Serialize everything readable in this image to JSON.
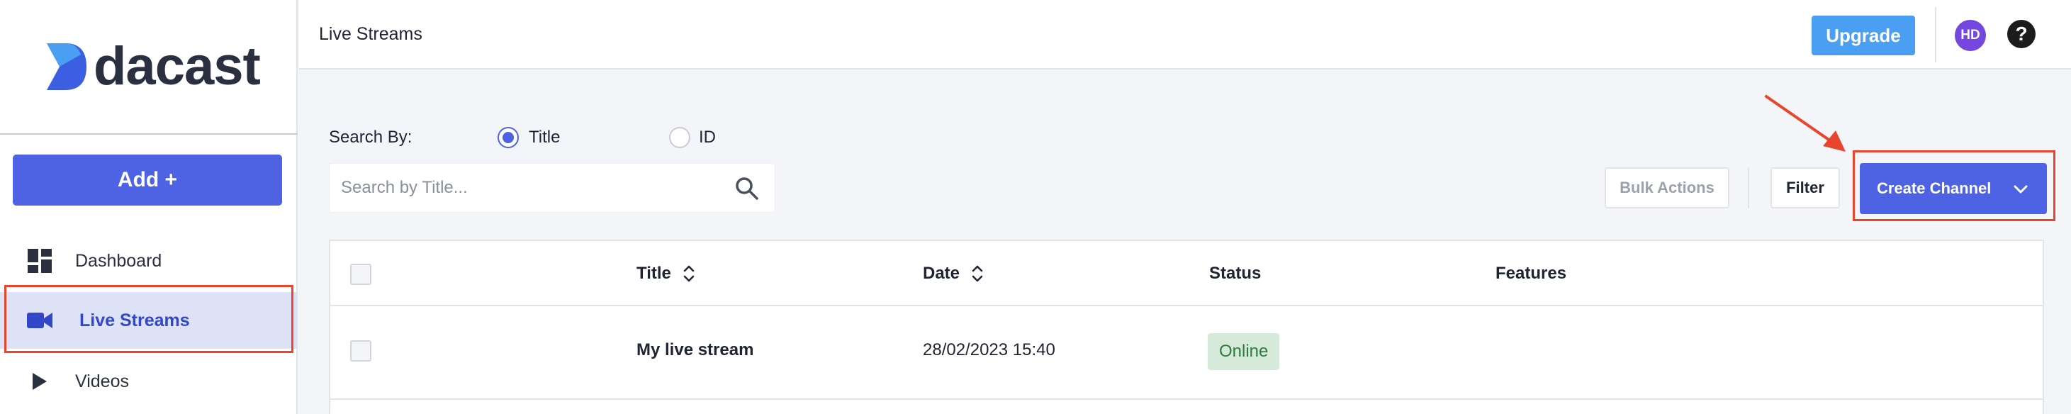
{
  "app": {
    "logo_text": "dacast"
  },
  "sidebar": {
    "add_label": "Add +",
    "items": [
      {
        "label": "Dashboard",
        "icon": "dashboard-icon"
      },
      {
        "label": "Live Streams",
        "icon": "video-camera-icon",
        "active": true
      },
      {
        "label": "Videos",
        "icon": "play-icon"
      }
    ]
  },
  "header": {
    "title": "Live Streams",
    "upgrade_label": "Upgrade",
    "avatar_initials": "HD",
    "help_glyph": "?"
  },
  "search": {
    "label": "Search By:",
    "options": [
      {
        "label": "Title",
        "selected": true
      },
      {
        "label": "ID",
        "selected": false
      }
    ],
    "placeholder": "Search by Title...",
    "value": ""
  },
  "toolbar": {
    "bulk_actions_label": "Bulk Actions",
    "filter_label": "Filter",
    "create_channel_label": "Create Channel"
  },
  "table": {
    "columns": [
      "Title",
      "Date",
      "Status",
      "Features"
    ],
    "rows": [
      {
        "title": "My live stream",
        "date": "28/02/2023 15:40",
        "status": "Online",
        "features": ""
      }
    ]
  },
  "colors": {
    "accent": "#4d63e4",
    "upgrade": "#4a9ff2",
    "highlight": "#e8452c",
    "status_online_bg": "#d5ead8",
    "status_online_text": "#2e7a3c",
    "avatar": "#7547df"
  }
}
